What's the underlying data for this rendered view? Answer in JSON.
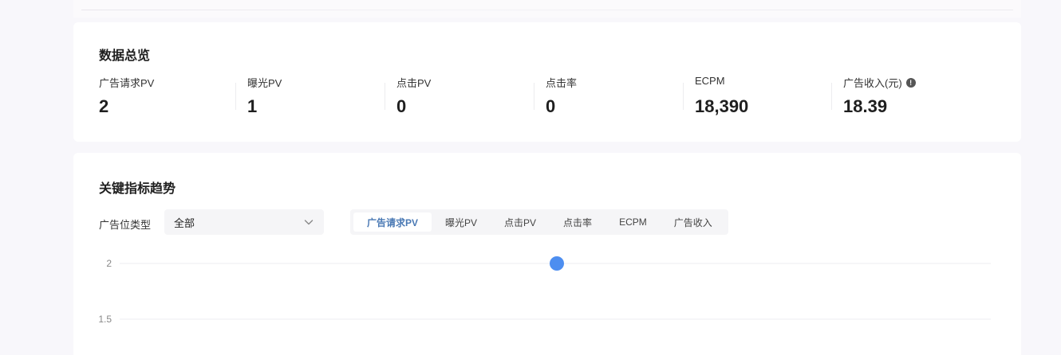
{
  "overview": {
    "title": "数据总览",
    "metrics": [
      {
        "label": "广告请求PV",
        "value": "2"
      },
      {
        "label": "曝光PV",
        "value": "1"
      },
      {
        "label": "点击PV",
        "value": "0"
      },
      {
        "label": "点击率",
        "value": "0"
      },
      {
        "label": "ECPM",
        "value": "18,390"
      },
      {
        "label": "广告收入(元)",
        "value": "18.39",
        "icon": "info-icon"
      }
    ]
  },
  "trend": {
    "title": "关键指标趋势",
    "filter": {
      "label": "广告位类型",
      "value": "全部",
      "icon": "chevron-down-icon"
    },
    "tabs": [
      {
        "label": "广告请求PV",
        "active": true
      },
      {
        "label": "曝光PV",
        "active": false
      },
      {
        "label": "点击PV",
        "active": false
      },
      {
        "label": "点击率",
        "active": false
      },
      {
        "label": "ECPM",
        "active": false
      },
      {
        "label": "广告收入",
        "active": false
      }
    ]
  },
  "colors": {
    "accent": "#4a79b4",
    "point": "#4d8ef0",
    "grid": "#ececf0"
  },
  "chart_data": {
    "type": "line",
    "yticks": [
      "2",
      "1.5"
    ],
    "ylim": [
      1.5,
      2
    ],
    "x": [
      0
    ],
    "series": [
      {
        "values": [
          2
        ]
      }
    ]
  }
}
